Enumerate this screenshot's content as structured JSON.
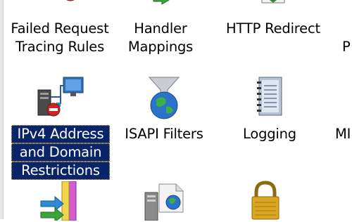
{
  "features": {
    "row1": [
      {
        "line1": "Failed Request",
        "line2": "Tracing Rules",
        "icon": "failed-request-tracing-icon"
      },
      {
        "line1": "Handler",
        "line2": "Mappings",
        "icon": "handler-mappings-icon"
      },
      {
        "line1": "HTTP Redirect",
        "line2": "",
        "icon": "http-redirect-icon"
      },
      {
        "line1": "",
        "line2": "P",
        "icon": "partial-icon"
      }
    ],
    "row2": [
      {
        "line1": "IPv4 Address",
        "line2": "and Domain",
        "line3": "Restrictions",
        "icon": "ipv4-restrictions-icon",
        "selected": true
      },
      {
        "line1": "ISAPI Filters",
        "icon": "isapi-filters-icon"
      },
      {
        "line1": "Logging",
        "icon": "logging-icon"
      },
      {
        "line1": "MI",
        "icon": "mime-types-icon"
      }
    ],
    "row3": [
      {
        "icon": "modules-icon"
      },
      {
        "icon": "output-caching-icon"
      },
      {
        "icon": "lock-icon"
      }
    ]
  },
  "colors": {
    "selection": "#0a246a",
    "selection_text": "#ffffff"
  }
}
